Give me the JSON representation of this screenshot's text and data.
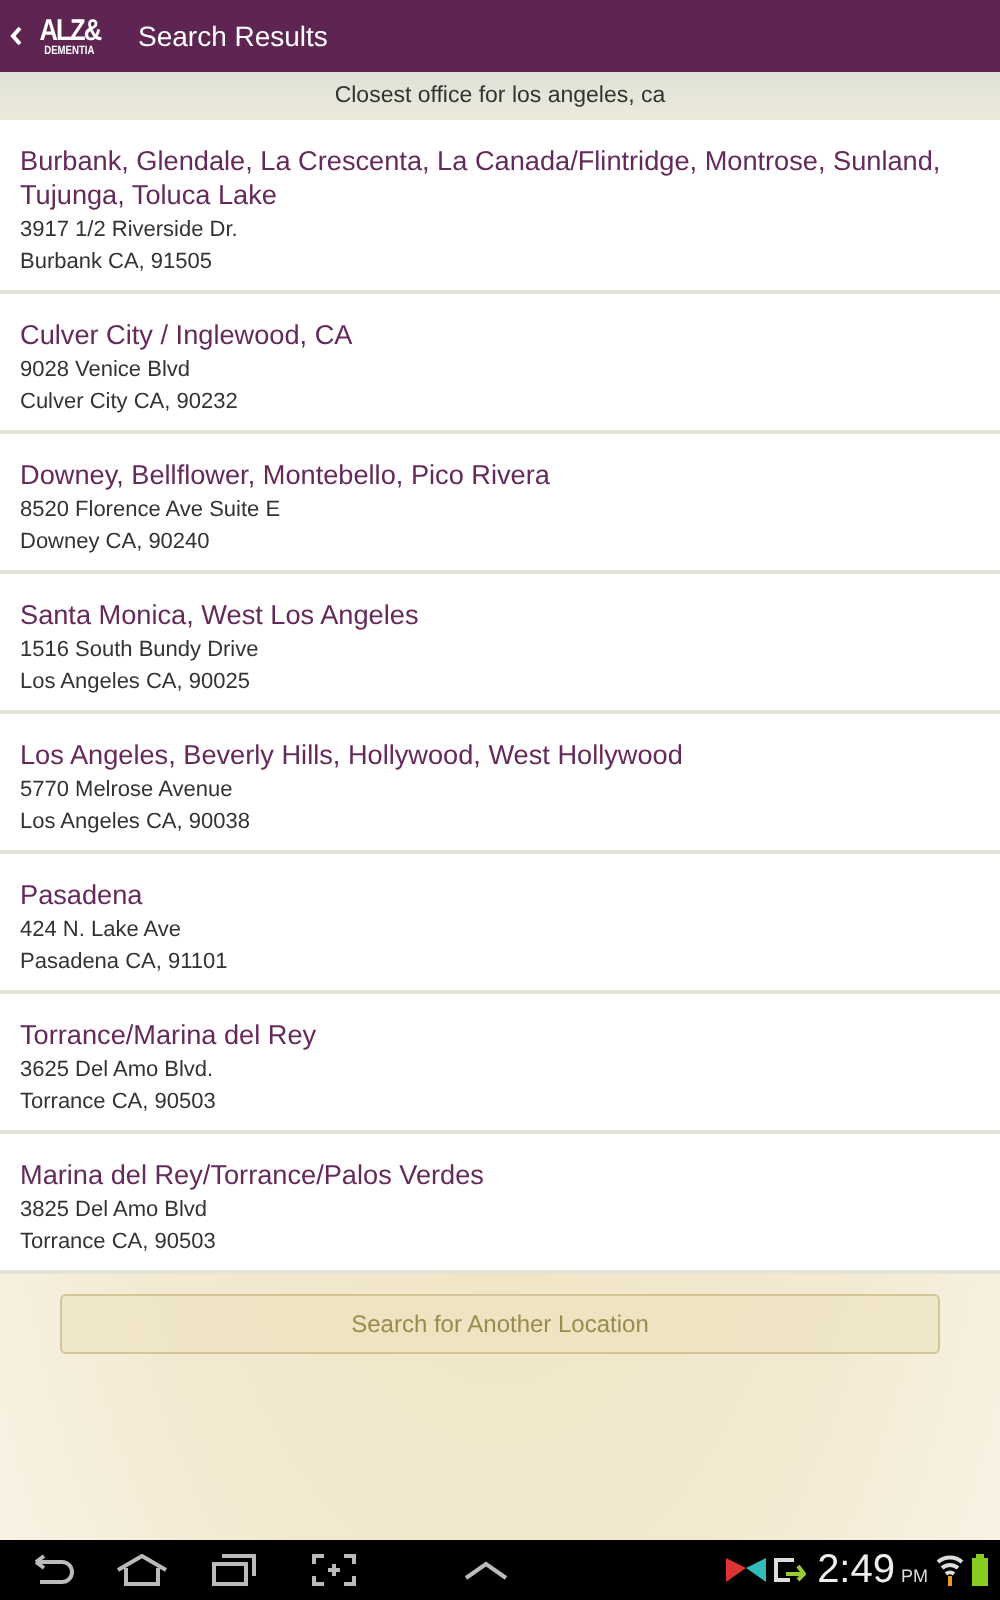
{
  "header": {
    "logo_top": "ALZ&",
    "logo_bottom": "DEMENTIA",
    "title": "Search Results"
  },
  "subtitle": "Closest office for los angeles, ca",
  "offices": [
    {
      "name": "Burbank, Glendale, La Crescenta, La Canada/Flintridge, Montrose, Sunland, Tujunga, Toluca Lake",
      "street": "3917 1/2 Riverside Dr.",
      "city": "Burbank CA, 91505"
    },
    {
      "name": "Culver City / Inglewood, CA",
      "street": "9028 Venice Blvd",
      "city": "Culver City CA, 90232"
    },
    {
      "name": "Downey, Bellflower, Montebello, Pico Rivera",
      "street": "8520 Florence Ave Suite E",
      "city": "Downey CA, 90240"
    },
    {
      "name": "Santa Monica, West Los Angeles",
      "street": "1516 South Bundy Drive",
      "city": "Los Angeles CA, 90025"
    },
    {
      "name": "Los Angeles, Beverly Hills, Hollywood, West Hollywood",
      "street": "5770 Melrose Avenue",
      "city": "Los Angeles CA, 90038"
    },
    {
      "name": "Pasadena",
      "street": "424 N. Lake Ave",
      "city": "Pasadena CA, 91101"
    },
    {
      "name": "Torrance/Marina del Rey",
      "street": "3625 Del Amo Blvd.",
      "city": "Torrance CA, 90503"
    },
    {
      "name": "Marina del Rey/Torrance/Palos Verdes",
      "street": "3825 Del Amo Blvd",
      "city": "Torrance CA, 90503"
    }
  ],
  "search_button": "Search for Another Location",
  "status_bar": {
    "time": "2:49",
    "ampm": "PM"
  }
}
